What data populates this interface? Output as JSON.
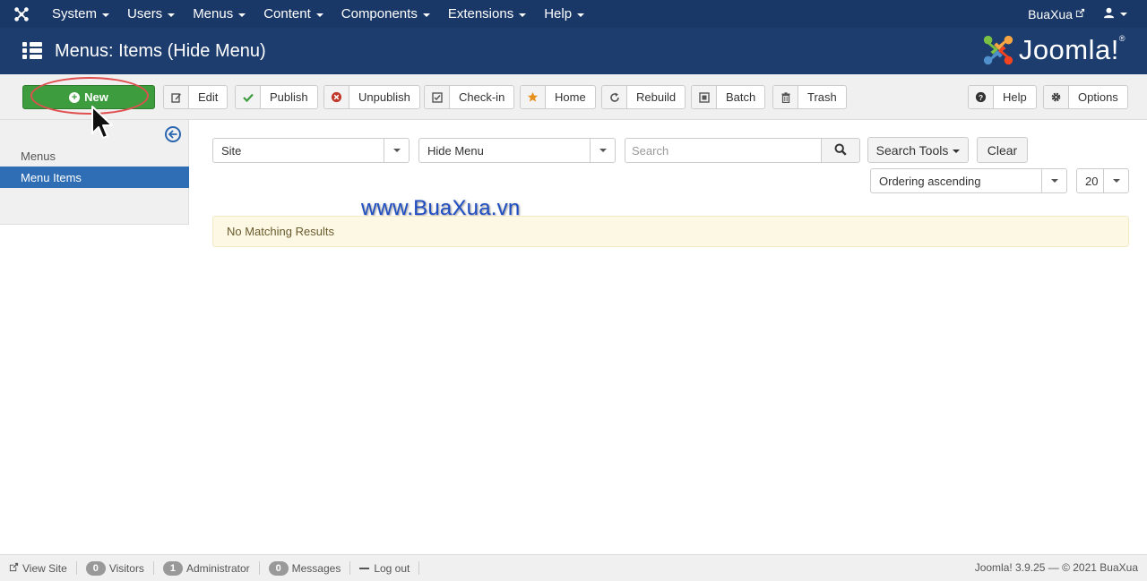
{
  "topnav": {
    "items": [
      {
        "label": "System"
      },
      {
        "label": "Users"
      },
      {
        "label": "Menus"
      },
      {
        "label": "Content"
      },
      {
        "label": "Components"
      },
      {
        "label": "Extensions"
      },
      {
        "label": "Help"
      }
    ],
    "site_link": "BuaXua"
  },
  "header": {
    "title": "Menus: Items (Hide Menu)",
    "brand": "Joomla!",
    "brand_mark": "®"
  },
  "toolbar": {
    "new_label": "New",
    "edit_label": "Edit",
    "publish_label": "Publish",
    "unpublish_label": "Unpublish",
    "checkin_label": "Check-in",
    "home_label": "Home",
    "rebuild_label": "Rebuild",
    "batch_label": "Batch",
    "trash_label": "Trash",
    "help_label": "Help",
    "options_label": "Options"
  },
  "sidebar": {
    "items": [
      {
        "label": "Menus",
        "active": false
      },
      {
        "label": "Menu Items",
        "active": true
      }
    ]
  },
  "filters": {
    "client": "Site",
    "menu": "Hide Menu",
    "search_placeholder": "Search",
    "search_tools_label": "Search Tools",
    "clear_label": "Clear",
    "ordering": "Ordering ascending",
    "limit": "20"
  },
  "results": {
    "message": "No Matching Results"
  },
  "watermark": "www.BuaXua.vn",
  "statusbar": {
    "view_site": "View Site",
    "visitors_count": "0",
    "visitors_label": "Visitors",
    "admin_count": "1",
    "admin_label": "Administrator",
    "messages_count": "0",
    "messages_label": "Messages",
    "logout": "Log out",
    "version": "Joomla! 3.9.25 — © 2021 BuaXua"
  },
  "colors": {
    "navbar": "#1a3867",
    "header": "#1c3d6e",
    "new_button": "#3d9c3d",
    "active_sidebar": "#2f6eb5",
    "alert_bg": "#fcf8e3"
  }
}
